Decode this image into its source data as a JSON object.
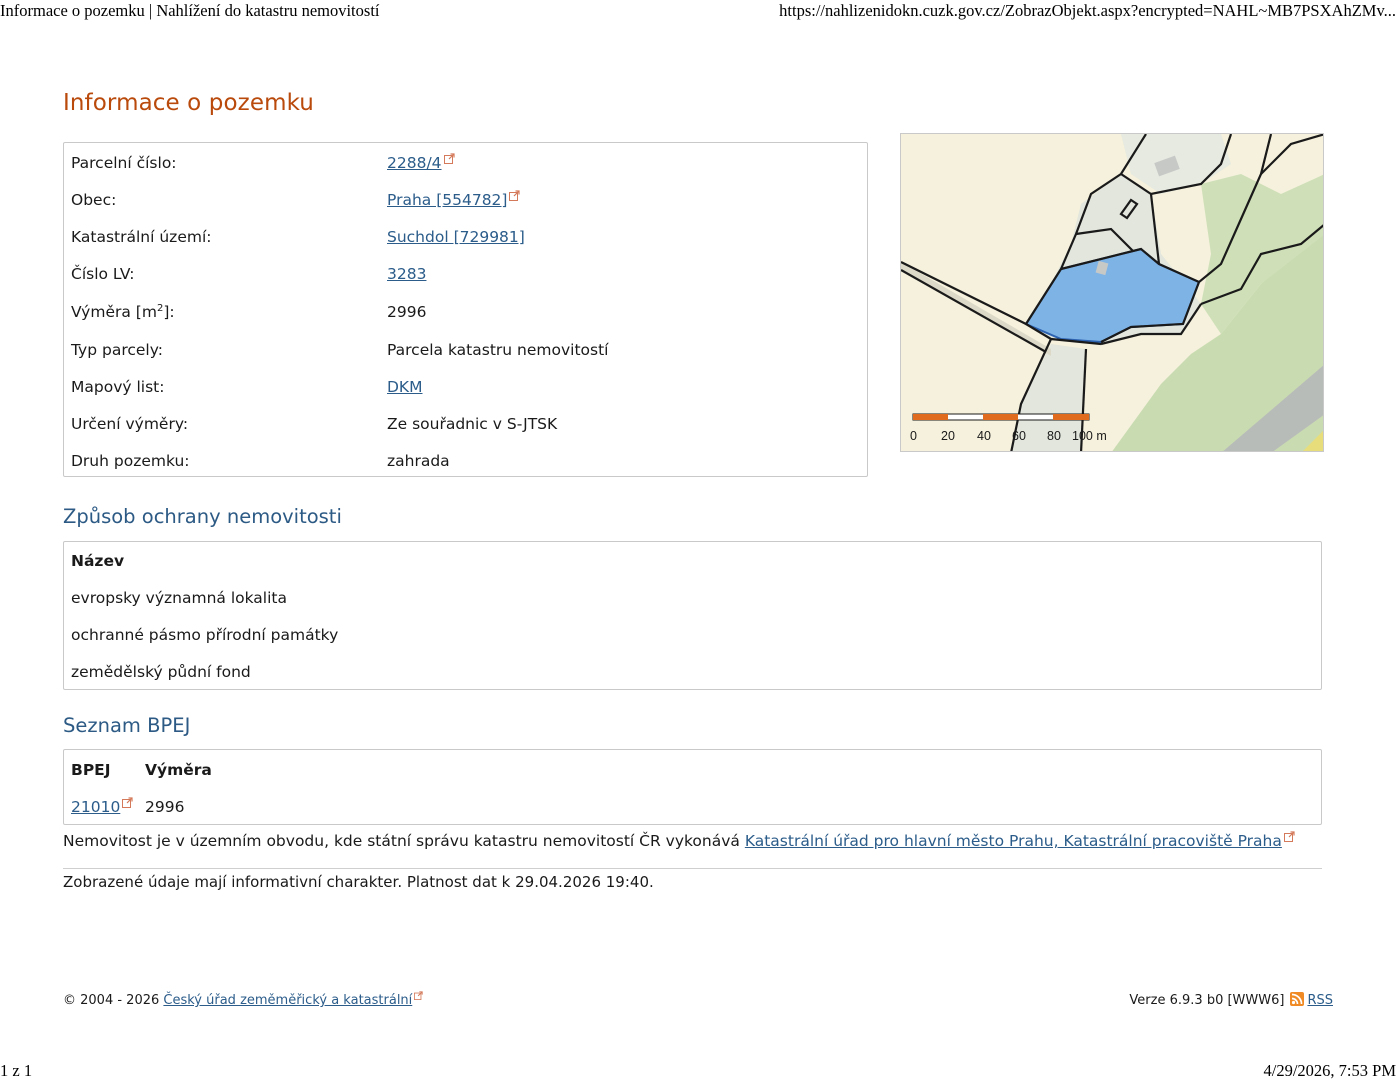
{
  "print": {
    "title": "Informace o pozemku | Nahlížení do katastru nemovitostí",
    "url": "https://nahlizenidokn.cuzk.gov.cz/ZobrazObjekt.aspx?encrypted=NAHL~MB7PSXAhZMv...",
    "page": "1 z 1",
    "datetime": "4/29/2026, 7:53 PM"
  },
  "heading": "Informace o pozemku",
  "info": {
    "parcel_number": {
      "label": "Parcelní číslo:",
      "value": "2288/4"
    },
    "municipality": {
      "label": "Obec:",
      "value": "Praha [554782]"
    },
    "cadastral_area": {
      "label": "Katastrální území:",
      "value": "Suchdol [729981]"
    },
    "lv_number": {
      "label": "Číslo LV:",
      "value": "3283"
    },
    "area": {
      "label_pre": "Výměra [m",
      "label_sup": "2",
      "label_post": "]:",
      "value": "2996"
    },
    "parcel_type": {
      "label": "Typ parcely:",
      "value": "Parcela katastru nemovitostí"
    },
    "map_sheet": {
      "label": "Mapový list:",
      "value": "DKM"
    },
    "area_determination": {
      "label": "Určení výměry:",
      "value": "Ze souřadnic v S-JTSK"
    },
    "land_type": {
      "label": "Druh pozemku:",
      "value": "zahrada"
    }
  },
  "map": {
    "scale_labels": [
      "0",
      "20",
      "40",
      "60",
      "80",
      "100 m"
    ],
    "colors": {
      "parcel": "#7eb3e6",
      "meadow": "#f5f1dc",
      "green": "#c9dbb1",
      "plot": "#e2e6dc",
      "scale_orange": "#e06a1e"
    }
  },
  "protection": {
    "heading": "Způsob ochrany nemovitosti",
    "column": "Název",
    "items": [
      "evropsky významná lokalita",
      "ochranné pásmo přírodní památky",
      "zemědělský půdní fond"
    ]
  },
  "bpej": {
    "heading": "Seznam BPEJ",
    "columns": [
      "BPEJ",
      "Výměra"
    ],
    "rows": [
      {
        "code": "21010",
        "area": "2996"
      }
    ]
  },
  "notice": {
    "text": "Nemovitost je v územním obvodu, kde státní správu katastru nemovitostí ČR vykonává ",
    "link": "Katastrální úřad pro hlavní město Prahu, Katastrální pracoviště Praha"
  },
  "validity": "Zobrazené údaje mají informativní charakter. Platnost dat k 29.04.2026 19:40.",
  "footer": {
    "copyright": "© 2004 - 2026 ",
    "org_link": "Český úřad zeměměřický a katastrální",
    "version": "Verze 6.9.3 b0 [WWW6]",
    "rss": "RSS"
  },
  "icons": {
    "external": "external-link-icon",
    "rss": "rss-icon"
  }
}
